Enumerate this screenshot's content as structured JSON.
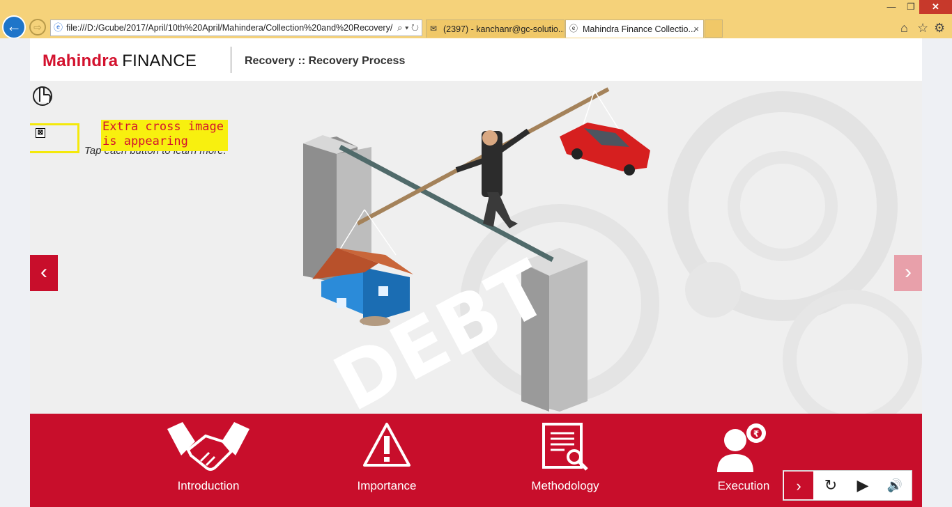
{
  "browser": {
    "address": "file:///D:/Gcube/2017/April/10th%20April/Mahindera/Collection%20and%20Recovery/",
    "tabs": [
      {
        "label": "(2397) - kanchanr@gc-solutio...",
        "icon": "mail-icon"
      },
      {
        "label": "Mahindra Finance Collectio...",
        "icon": "ie-icon"
      }
    ],
    "tab_close": "×",
    "window": {
      "minimize": "—",
      "maximize": "❐",
      "close": "✕"
    },
    "nav": {
      "back": "←",
      "forward": "⇨"
    }
  },
  "header": {
    "logo_brand": "Mahindra",
    "logo_suffix": "FINANCE",
    "title": "Recovery :: Recovery Process"
  },
  "stage": {
    "instruction": "Tap each button to learn more.",
    "annotation": "Extra cross image is appearing",
    "broken_image_glyph": "⊠",
    "debt_text": "DEBT",
    "prev_label": "‹",
    "next_label": "›"
  },
  "menu": [
    {
      "label": "Introduction",
      "icon": "handshake-icon"
    },
    {
      "label": "Importance",
      "icon": "warning-icon"
    },
    {
      "label": "Methodology",
      "icon": "document-search-icon"
    },
    {
      "label": "Execution",
      "icon": "person-gear-icon"
    }
  ],
  "controls": {
    "next": "›",
    "replay": "↻",
    "play": "▶",
    "sound": "🔊"
  },
  "colors": {
    "brand_red": "#c80e2b",
    "chrome_yellow": "#f5d27a",
    "annotation_yellow": "#f8f00f"
  }
}
